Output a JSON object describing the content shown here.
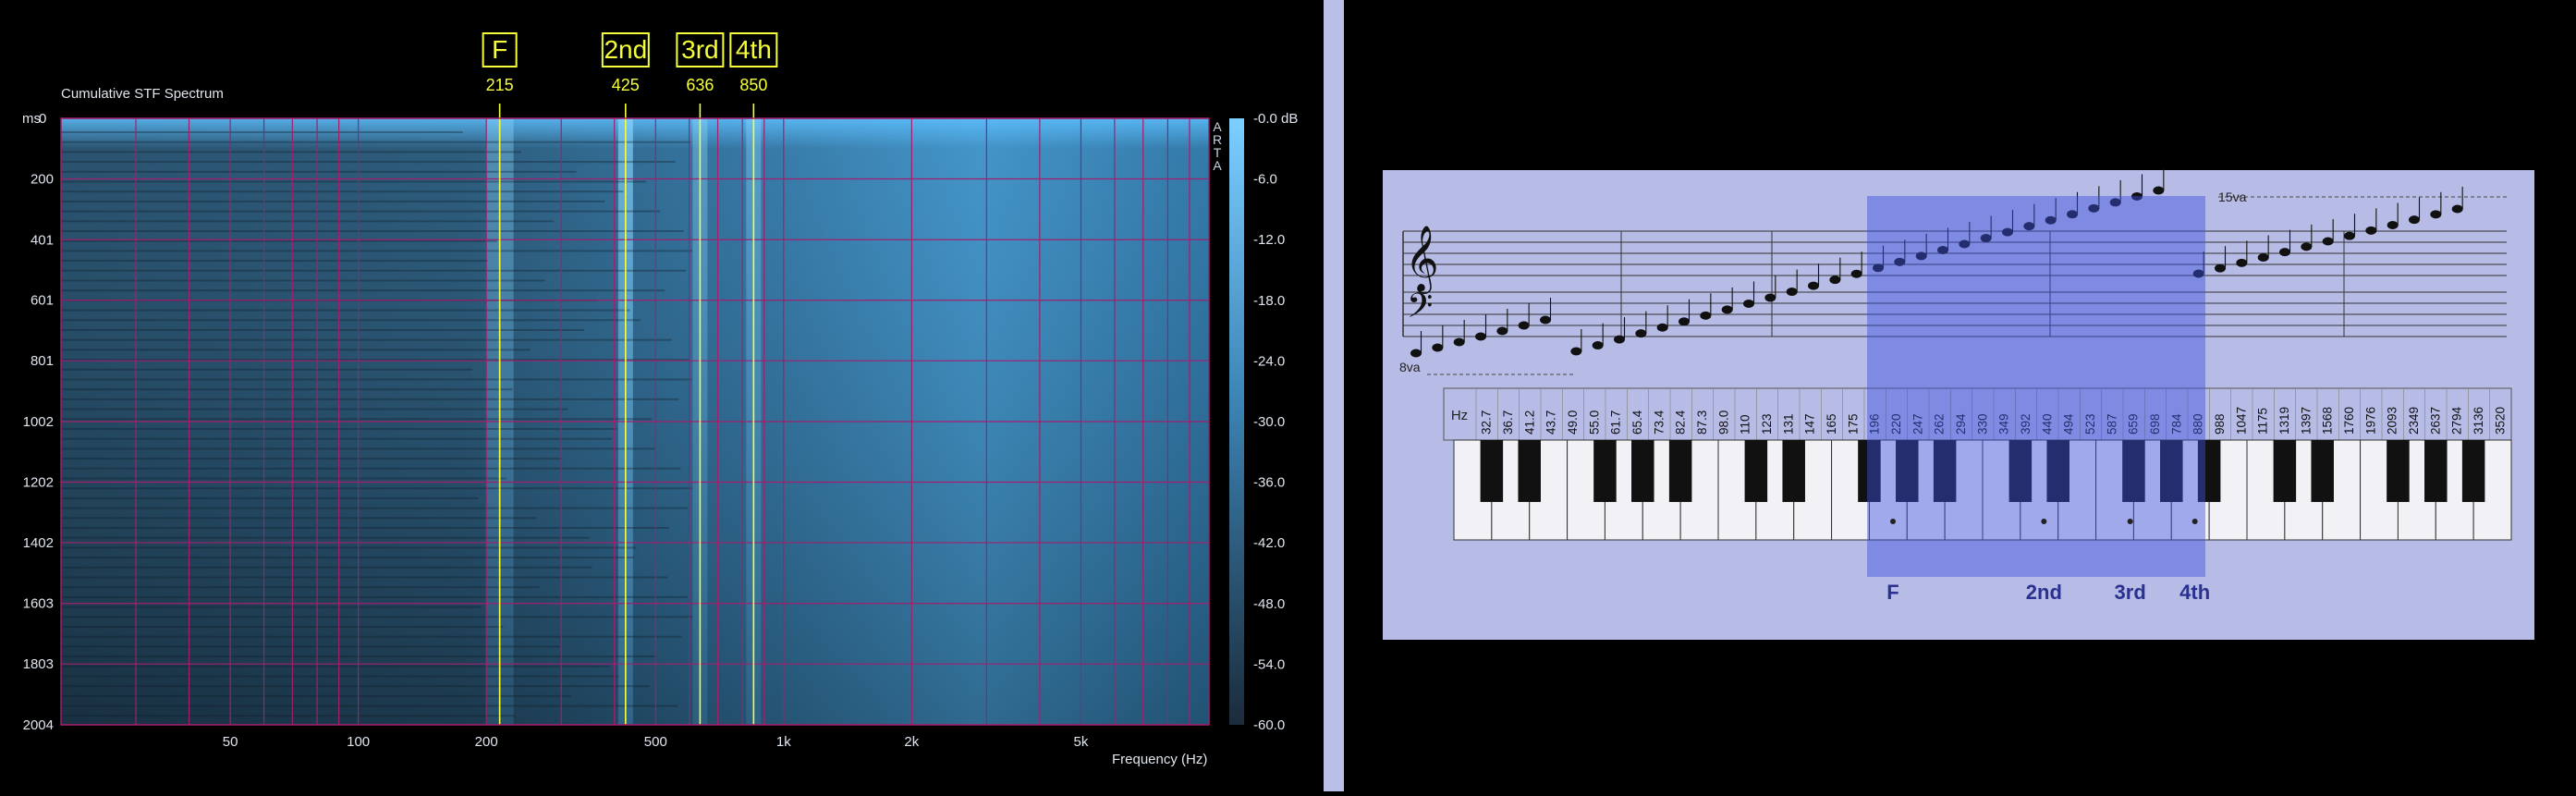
{
  "spectrum": {
    "title": "Cumulative STF Spectrum",
    "watermark": "ARTA",
    "y_unit_label": "ms",
    "y_ticks": [
      "0",
      "200",
      "401",
      "601",
      "801",
      "1002",
      "1202",
      "1402",
      "1603",
      "1803",
      "2004"
    ],
    "x_ticks": [
      "50",
      "100",
      "200",
      "500",
      "1k",
      "2k",
      "5k"
    ],
    "x_label": "Frequency (Hz)",
    "db_ticks": [
      "-0.0 dB",
      "-6.0",
      "-12.0",
      "-18.0",
      "-24.0",
      "-30.0",
      "-36.0",
      "-42.0",
      "-48.0",
      "-54.0",
      "-60.0"
    ],
    "markers": [
      {
        "label": "F",
        "freq": "215"
      },
      {
        "label": "2nd",
        "freq": "425"
      },
      {
        "label": "3rd",
        "freq": "636"
      },
      {
        "label": "4th",
        "freq": "850"
      }
    ],
    "colors": {
      "marker": "#f6ff3a",
      "grid": "#a0206e",
      "colormap_low": "#1a2a3a",
      "colormap_high": "#6ac6ff"
    }
  },
  "keyboard": {
    "hz_label": "Hz",
    "octave_low_label": "8va",
    "octave_high_label": "15va",
    "frequencies": [
      "32.7",
      "36.7",
      "41.2",
      "43.7",
      "49.0",
      "55.0",
      "61.7",
      "65.4",
      "73.4",
      "82.4",
      "87.3",
      "98.0",
      "110",
      "123",
      "131",
      "147",
      "165",
      "175",
      "196",
      "220",
      "247",
      "262",
      "294",
      "330",
      "349",
      "392",
      "440",
      "494",
      "523",
      "587",
      "659",
      "698",
      "784",
      "880",
      "988",
      "1047",
      "1175",
      "1319",
      "1397",
      "1568",
      "1760",
      "1976",
      "2093",
      "2349",
      "2637",
      "2794",
      "3136",
      "3520"
    ],
    "range_labels": [
      "F",
      "2nd",
      "3rd",
      "4th"
    ],
    "highlight_color": "#3c4fe0"
  },
  "chart_data": {
    "type": "heatmap",
    "title": "Cumulative STF Spectrum",
    "xlabel": "Frequency (Hz)",
    "ylabel": "ms",
    "x_scale": "log",
    "xlim": [
      20,
      10000
    ],
    "ylim": [
      0,
      2004
    ],
    "zlim": [
      -60,
      0
    ],
    "z_unit": "dB",
    "x_ticks": [
      50,
      100,
      200,
      500,
      1000,
      2000,
      5000
    ],
    "y_ticks": [
      0,
      200,
      401,
      601,
      801,
      1002,
      1202,
      1402,
      1603,
      1803,
      2004
    ],
    "z_ticks": [
      0,
      -6,
      -12,
      -18,
      -24,
      -30,
      -36,
      -42,
      -48,
      -54,
      -60
    ],
    "grid": true,
    "peaks_hz": [
      215,
      425,
      636,
      850
    ],
    "peak_labels": [
      "F",
      "2nd",
      "3rd",
      "4th"
    ]
  }
}
